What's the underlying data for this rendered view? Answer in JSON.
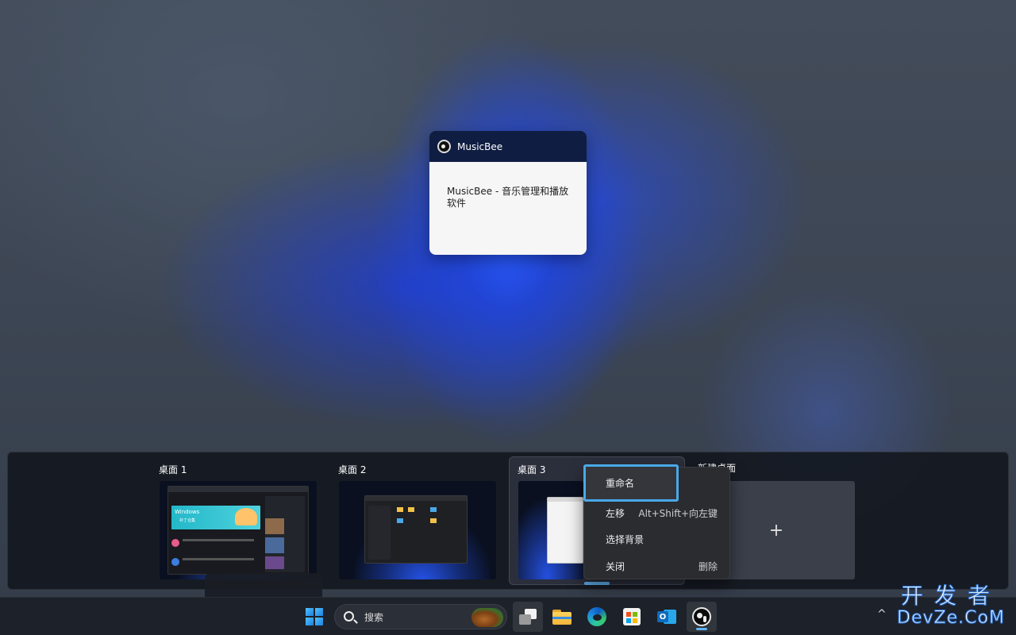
{
  "app_window": {
    "title": "MusicBee",
    "description": "MusicBee - 音乐管理和播放软件",
    "icon": "musicbee-icon"
  },
  "desktops": [
    {
      "label": "桌面 1",
      "thumb_web_text": "Windows",
      "thumb_web_subtext": "补丁合集"
    },
    {
      "label": "桌面 2"
    },
    {
      "label": "桌面 3"
    },
    {
      "label": "新建桌面",
      "icon": "plus-icon"
    }
  ],
  "context_menu": {
    "items": [
      {
        "label": "重命名",
        "shortcut": ""
      },
      {
        "label": "左移",
        "shortcut": "Alt+Shift+向左键"
      },
      {
        "label": "选择背景",
        "shortcut": ""
      },
      {
        "label": "关闭",
        "shortcut": "删除"
      }
    ],
    "focused_index": 0
  },
  "taskbar": {
    "search_placeholder": "搜索",
    "apps": [
      "start-icon",
      "task-view-icon",
      "file-explorer-icon",
      "edge-icon",
      "store-icon",
      "outlook-icon",
      "musicbee-icon"
    ],
    "tray": {
      "chevron": "^"
    }
  },
  "watermark": {
    "line1": "开发者",
    "line2": "DevZe.CoM"
  },
  "colors": {
    "accent": "#4aa8e8",
    "taskbar": "#1d2129",
    "menu_bg": "#2b2c30",
    "titlebar": "#0f1d42"
  }
}
